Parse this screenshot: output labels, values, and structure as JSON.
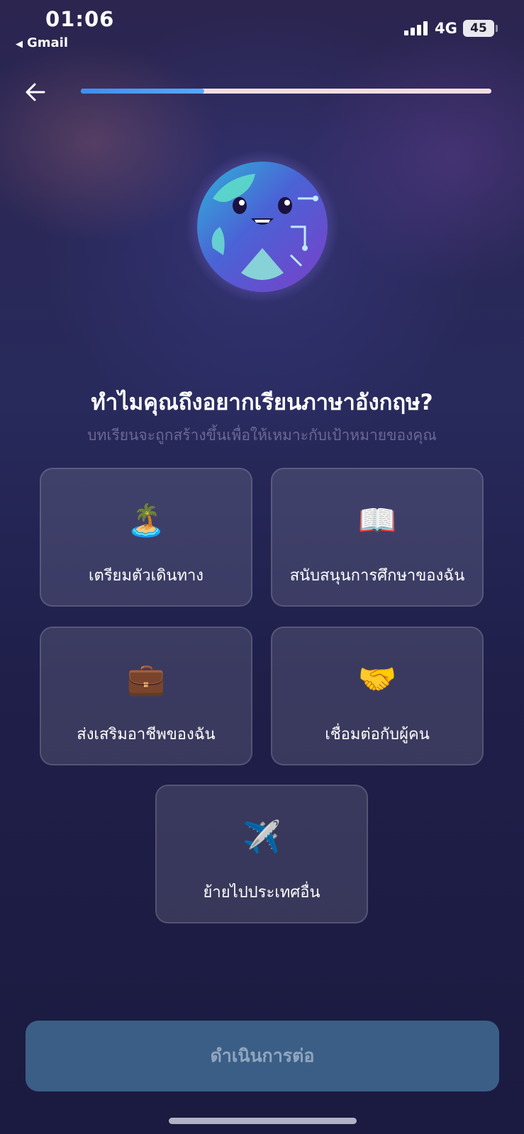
{
  "status_bar": {
    "time": "01:06",
    "back_app": "Gmail",
    "network": "4G",
    "battery": "45"
  },
  "header": {
    "back_icon": "arrow-left-icon",
    "progress_fraction": 0.3
  },
  "mascot": {
    "icon": "smiling-globe-mascot"
  },
  "question": {
    "title": "ทำไมคุณถึงอยากเรียนภาษาอังกฤษ?",
    "subtitle": "บทเรียนจะถูกสร้างขึ้นเพื่อให้เหมาะกับเป้าหมายของคุณ"
  },
  "options": [
    {
      "emoji": "🏝️",
      "icon": "island-icon",
      "label": "เตรียมตัวเดินทาง"
    },
    {
      "emoji": "📖",
      "icon": "open-book-icon",
      "label": "สนับสนุนการศึกษาของฉัน"
    },
    {
      "emoji": "💼",
      "icon": "briefcase-icon",
      "label": "ส่งเสริมอาชีพของฉัน"
    },
    {
      "emoji": "🤝",
      "icon": "handshake-icon",
      "label": "เชื่อมต่อกับผู้คน"
    },
    {
      "emoji": "✈️",
      "icon": "airplane-icon",
      "label": "ย้ายไปประเทศอื่น"
    }
  ],
  "footer": {
    "continue_label": "ดำเนินการต่อ"
  },
  "colors": {
    "accent": "#4a9bf7",
    "button": "#3b5e86",
    "card": "#3f3e66"
  }
}
